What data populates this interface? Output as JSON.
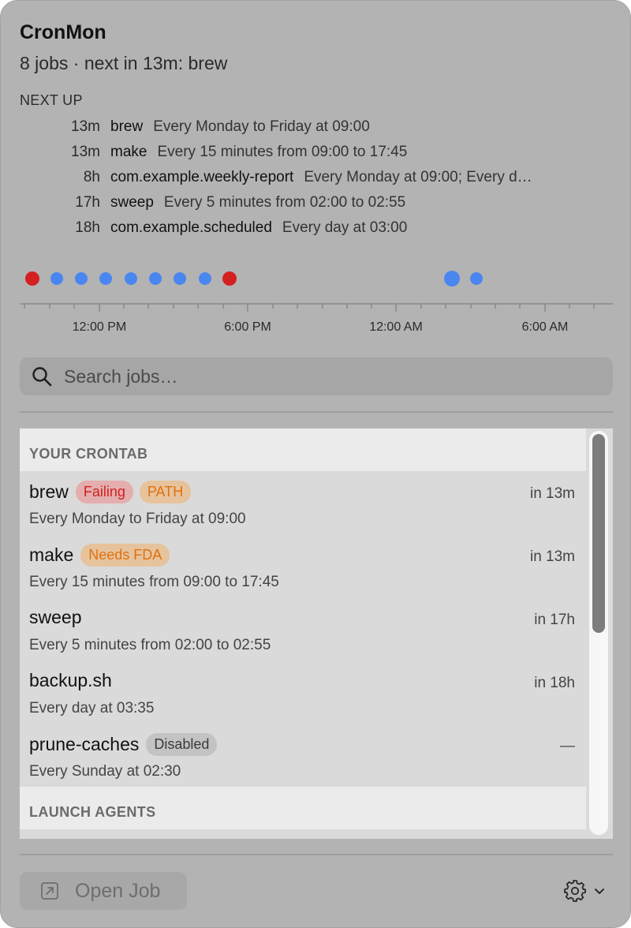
{
  "app": {
    "title": "CronMon",
    "subtitle": "8 jobs · next in 13m: brew"
  },
  "next_up": {
    "label": "NEXT UP",
    "items": [
      {
        "eta": "13m",
        "name": "brew",
        "schedule": "Every Monday to Friday at 09:00"
      },
      {
        "eta": "13m",
        "name": "make",
        "schedule": "Every 15 minutes from 09:00 to 17:45"
      },
      {
        "eta": "8h",
        "name": "com.example.weekly-report",
        "schedule": "Every Monday at 09:00; Every d…"
      },
      {
        "eta": "17h",
        "name": "sweep",
        "schedule": "Every 5 minutes from 02:00 to 02:55"
      },
      {
        "eta": "18h",
        "name": "com.example.scheduled",
        "schedule": "Every day at 03:00"
      }
    ]
  },
  "timeline": {
    "tick_labels": [
      "12:00 PM",
      "6:00 PM",
      "12:00 AM",
      "6:00 AM"
    ],
    "colors": {
      "normal": "#4a86f0",
      "failing": "#d42020"
    }
  },
  "search": {
    "placeholder": "Search jobs…",
    "value": "",
    "icon": "search-icon"
  },
  "crontab": {
    "header": "YOUR CRONTAB",
    "jobs": [
      {
        "name": "brew",
        "badges": [
          "Failing",
          "PATH"
        ],
        "schedule": "Every Monday to Friday at 09:00",
        "eta": "in 13m"
      },
      {
        "name": "make",
        "badges": [
          "Needs FDA"
        ],
        "schedule": "Every 15 minutes from 09:00 to 17:45",
        "eta": "in 13m"
      },
      {
        "name": "sweep",
        "badges": [],
        "schedule": "Every 5 minutes from 02:00 to 02:55",
        "eta": "in 17h"
      },
      {
        "name": "backup.sh",
        "badges": [],
        "schedule": "Every day at 03:35",
        "eta": "in 18h"
      },
      {
        "name": "prune-caches",
        "badges": [
          "Disabled"
        ],
        "schedule": "Every Sunday at 02:30",
        "eta": "—"
      }
    ]
  },
  "launch_agents": {
    "header": "LAUNCH AGENTS"
  },
  "footer": {
    "open_job_label": "Open Job",
    "open_icon": "open-external-icon",
    "settings_icon": "gear-icon",
    "chevron_icon": "chevron-down-icon"
  },
  "colors": {
    "failing": "#d21f1f",
    "warning": "#e0700f",
    "accent": "#4a86f0"
  }
}
